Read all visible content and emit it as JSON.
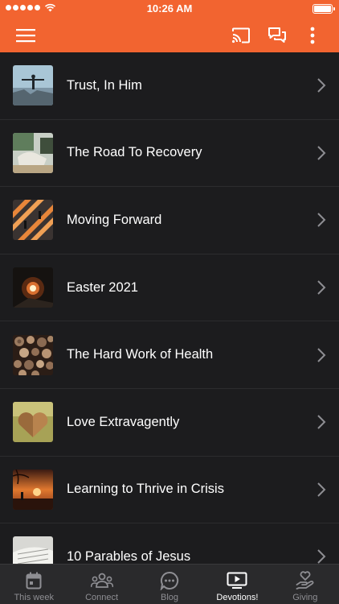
{
  "status_bar": {
    "time": "10:26 AM"
  },
  "app_bar": {
    "menu_icon": "hamburger-menu-icon",
    "cast_icon": "cast-icon",
    "chat_icon": "chat-bubbles-icon",
    "more_icon": "more-vertical-icon"
  },
  "colors": {
    "brand": "#f26430",
    "background": "#1c1c1e",
    "tab_bar": "#2a2a2c"
  },
  "devotions": [
    {
      "title": "Trust, In Him"
    },
    {
      "title": "The Road To Recovery"
    },
    {
      "title": "Moving Forward"
    },
    {
      "title": "Easter 2021"
    },
    {
      "title": "The Hard Work of Health"
    },
    {
      "title": "Love Extravagently"
    },
    {
      "title": "Learning to Thrive in Crisis"
    },
    {
      "title": "10 Parables of Jesus"
    }
  ],
  "tab_bar": {
    "tabs": [
      {
        "label": "This week",
        "icon": "calendar-icon"
      },
      {
        "label": "Connect",
        "icon": "people-icon"
      },
      {
        "label": "Blog",
        "icon": "chat-dots-icon"
      },
      {
        "label": "Devotions!",
        "icon": "play-screen-icon"
      },
      {
        "label": "Giving",
        "icon": "giving-hand-heart-icon"
      }
    ],
    "active": "Devotions!"
  }
}
